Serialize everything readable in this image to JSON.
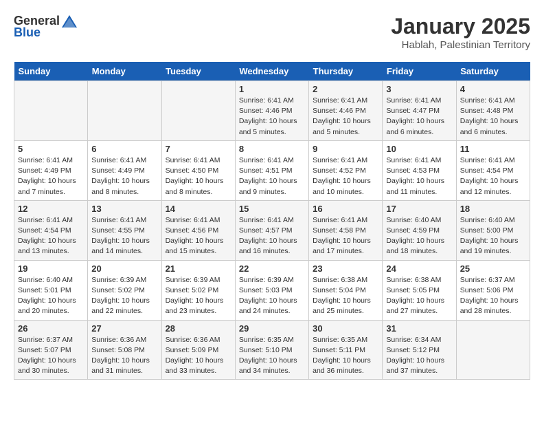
{
  "logo": {
    "general": "General",
    "blue": "Blue"
  },
  "title": "January 2025",
  "subtitle": "Hablah, Palestinian Territory",
  "days_of_week": [
    "Sunday",
    "Monday",
    "Tuesday",
    "Wednesday",
    "Thursday",
    "Friday",
    "Saturday"
  ],
  "weeks": [
    [
      {
        "day": "",
        "info": ""
      },
      {
        "day": "",
        "info": ""
      },
      {
        "day": "",
        "info": ""
      },
      {
        "day": "1",
        "info": "Sunrise: 6:41 AM\nSunset: 4:46 PM\nDaylight: 10 hours\nand 5 minutes."
      },
      {
        "day": "2",
        "info": "Sunrise: 6:41 AM\nSunset: 4:46 PM\nDaylight: 10 hours\nand 5 minutes."
      },
      {
        "day": "3",
        "info": "Sunrise: 6:41 AM\nSunset: 4:47 PM\nDaylight: 10 hours\nand 6 minutes."
      },
      {
        "day": "4",
        "info": "Sunrise: 6:41 AM\nSunset: 4:48 PM\nDaylight: 10 hours\nand 6 minutes."
      }
    ],
    [
      {
        "day": "5",
        "info": "Sunrise: 6:41 AM\nSunset: 4:49 PM\nDaylight: 10 hours\nand 7 minutes."
      },
      {
        "day": "6",
        "info": "Sunrise: 6:41 AM\nSunset: 4:49 PM\nDaylight: 10 hours\nand 8 minutes."
      },
      {
        "day": "7",
        "info": "Sunrise: 6:41 AM\nSunset: 4:50 PM\nDaylight: 10 hours\nand 8 minutes."
      },
      {
        "day": "8",
        "info": "Sunrise: 6:41 AM\nSunset: 4:51 PM\nDaylight: 10 hours\nand 9 minutes."
      },
      {
        "day": "9",
        "info": "Sunrise: 6:41 AM\nSunset: 4:52 PM\nDaylight: 10 hours\nand 10 minutes."
      },
      {
        "day": "10",
        "info": "Sunrise: 6:41 AM\nSunset: 4:53 PM\nDaylight: 10 hours\nand 11 minutes."
      },
      {
        "day": "11",
        "info": "Sunrise: 6:41 AM\nSunset: 4:54 PM\nDaylight: 10 hours\nand 12 minutes."
      }
    ],
    [
      {
        "day": "12",
        "info": "Sunrise: 6:41 AM\nSunset: 4:54 PM\nDaylight: 10 hours\nand 13 minutes."
      },
      {
        "day": "13",
        "info": "Sunrise: 6:41 AM\nSunset: 4:55 PM\nDaylight: 10 hours\nand 14 minutes."
      },
      {
        "day": "14",
        "info": "Sunrise: 6:41 AM\nSunset: 4:56 PM\nDaylight: 10 hours\nand 15 minutes."
      },
      {
        "day": "15",
        "info": "Sunrise: 6:41 AM\nSunset: 4:57 PM\nDaylight: 10 hours\nand 16 minutes."
      },
      {
        "day": "16",
        "info": "Sunrise: 6:41 AM\nSunset: 4:58 PM\nDaylight: 10 hours\nand 17 minutes."
      },
      {
        "day": "17",
        "info": "Sunrise: 6:40 AM\nSunset: 4:59 PM\nDaylight: 10 hours\nand 18 minutes."
      },
      {
        "day": "18",
        "info": "Sunrise: 6:40 AM\nSunset: 5:00 PM\nDaylight: 10 hours\nand 19 minutes."
      }
    ],
    [
      {
        "day": "19",
        "info": "Sunrise: 6:40 AM\nSunset: 5:01 PM\nDaylight: 10 hours\nand 20 minutes."
      },
      {
        "day": "20",
        "info": "Sunrise: 6:39 AM\nSunset: 5:02 PM\nDaylight: 10 hours\nand 22 minutes."
      },
      {
        "day": "21",
        "info": "Sunrise: 6:39 AM\nSunset: 5:02 PM\nDaylight: 10 hours\nand 23 minutes."
      },
      {
        "day": "22",
        "info": "Sunrise: 6:39 AM\nSunset: 5:03 PM\nDaylight: 10 hours\nand 24 minutes."
      },
      {
        "day": "23",
        "info": "Sunrise: 6:38 AM\nSunset: 5:04 PM\nDaylight: 10 hours\nand 25 minutes."
      },
      {
        "day": "24",
        "info": "Sunrise: 6:38 AM\nSunset: 5:05 PM\nDaylight: 10 hours\nand 27 minutes."
      },
      {
        "day": "25",
        "info": "Sunrise: 6:37 AM\nSunset: 5:06 PM\nDaylight: 10 hours\nand 28 minutes."
      }
    ],
    [
      {
        "day": "26",
        "info": "Sunrise: 6:37 AM\nSunset: 5:07 PM\nDaylight: 10 hours\nand 30 minutes."
      },
      {
        "day": "27",
        "info": "Sunrise: 6:36 AM\nSunset: 5:08 PM\nDaylight: 10 hours\nand 31 minutes."
      },
      {
        "day": "28",
        "info": "Sunrise: 6:36 AM\nSunset: 5:09 PM\nDaylight: 10 hours\nand 33 minutes."
      },
      {
        "day": "29",
        "info": "Sunrise: 6:35 AM\nSunset: 5:10 PM\nDaylight: 10 hours\nand 34 minutes."
      },
      {
        "day": "30",
        "info": "Sunrise: 6:35 AM\nSunset: 5:11 PM\nDaylight: 10 hours\nand 36 minutes."
      },
      {
        "day": "31",
        "info": "Sunrise: 6:34 AM\nSunset: 5:12 PM\nDaylight: 10 hours\nand 37 minutes."
      },
      {
        "day": "",
        "info": ""
      }
    ]
  ]
}
